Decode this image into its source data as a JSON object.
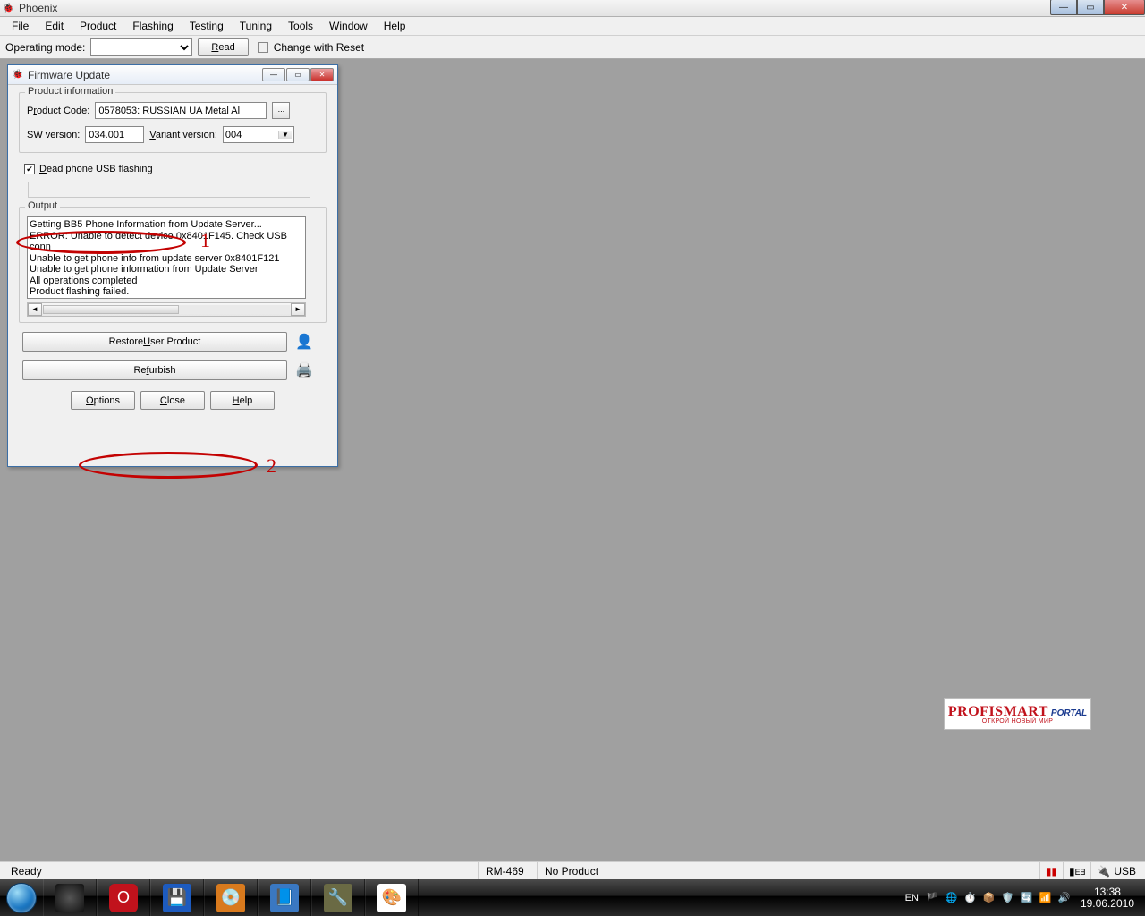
{
  "mainWindow": {
    "title": "Phoenix",
    "menu": [
      "File",
      "Edit",
      "Product",
      "Flashing",
      "Testing",
      "Tuning",
      "Tools",
      "Window",
      "Help"
    ],
    "toolbar": {
      "operatingModeLabel": "Operating mode:",
      "readBtn": "Read",
      "changeWithReset": "Change with Reset"
    }
  },
  "firmwareUpdate": {
    "title": "Firmware Update",
    "productInfoTitle": "Product information",
    "productCodeLabel": "Product Code:",
    "productCodeValue": "0578053: RUSSIAN UA Metal Al",
    "swVersionLabel": "SW version:",
    "swVersionValue": "034.001",
    "variantVersionLabel": "Variant version:",
    "variantVersionValue": "004",
    "deadPhoneLabel": "Dead phone USB flashing",
    "outputTitle": "Output",
    "outputText": "Getting BB5 Phone Information from Update Server...\nERROR: Unable to detect device 0x8401F145. Check USB conn\nUnable to get phone info from update server 0x8401F121\nUnable to get phone information from Update Server\nAll operations completed\nProduct flashing failed.",
    "restoreBtn": "Restore User Product",
    "refurbishBtn": "Refurbish",
    "optionsBtn": "Options",
    "closeBtn": "Close",
    "helpBtn": "Help"
  },
  "annotations": {
    "n1": "1",
    "n2": "2"
  },
  "watermark": {
    "line1a": "PROFISMART",
    "line1b": "PORTAL",
    "line2": "ОТКРОЙ НОВЫЙ МИР"
  },
  "statusbar": {
    "ready": "Ready",
    "rm": "RM-469",
    "noProduct": "No Product",
    "usb": "USB"
  },
  "taskbar": {
    "lang": "EN",
    "time": "13:38",
    "date": "19.06.2010"
  }
}
